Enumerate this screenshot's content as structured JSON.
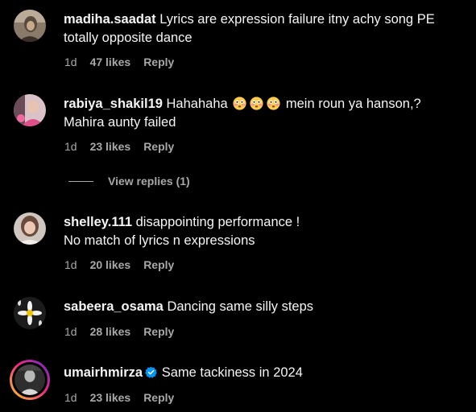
{
  "comments": [
    {
      "username": "madiha.saadat",
      "text": "Lyrics are expression failure itny achy song PE totally opposite dance",
      "time": "1d",
      "likes": "47 likes",
      "reply": "Reply"
    },
    {
      "username": "rabiya_shakil19",
      "text_before": "Hahahaha",
      "text_after": "mein roun ya hanson,? Mahira aunty failed",
      "emoji": "flushed-face-emoji",
      "time": "1d",
      "likes": "23 likes",
      "reply": "Reply",
      "view_replies": "View replies (1)"
    },
    {
      "username": "shelley.111",
      "line1": "disappointing performance !",
      "line2": "No match of lyrics n expressions",
      "time": "1d",
      "likes": "20 likes",
      "reply": "Reply"
    },
    {
      "username": "sabeera_osama",
      "text": "Dancing same silly steps",
      "time": "1d",
      "likes": "28 likes",
      "reply": "Reply"
    },
    {
      "username": "umairhmirza",
      "verified": true,
      "text": "Same tackiness in 2024",
      "time": "1d",
      "likes": "23 likes",
      "reply": "Reply"
    }
  ],
  "colors": {
    "background": "#000000",
    "text": "#f5f5f5",
    "meta": "#a8a8a8",
    "verified": "#0095f6"
  }
}
